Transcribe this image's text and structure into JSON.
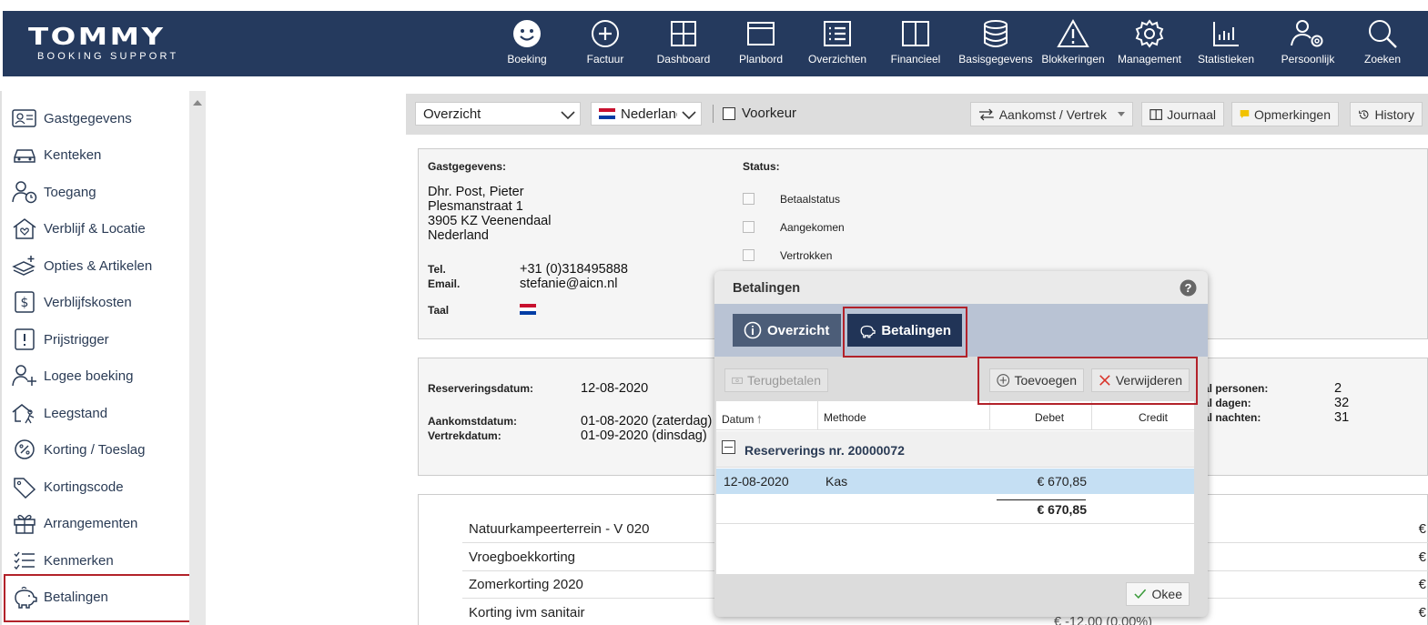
{
  "brand": {
    "name": "TOMMY",
    "tagline": "BOOKING SUPPORT"
  },
  "nav": [
    {
      "label": "Boeking",
      "icon": "smiley-icon"
    },
    {
      "label": "Factuur",
      "icon": "plus-circle-icon"
    },
    {
      "label": "Dashboard",
      "icon": "grid-icon"
    },
    {
      "label": "Planbord",
      "icon": "board-icon"
    },
    {
      "label": "Overzichten",
      "icon": "list-icon"
    },
    {
      "label": "Financieel",
      "icon": "book-icon"
    },
    {
      "label": "Basisgegevens",
      "icon": "database-icon"
    },
    {
      "label": "Blokkeringen",
      "icon": "warning-icon"
    },
    {
      "label": "Management",
      "icon": "gear-icon"
    },
    {
      "label": "Statistieken",
      "icon": "chart-icon"
    },
    {
      "label": "Persoonlijk",
      "icon": "user-gear-icon"
    },
    {
      "label": "Zoeken",
      "icon": "search-icon"
    }
  ],
  "sidebar": [
    {
      "label": "Gastgegevens",
      "icon": "id-card-icon"
    },
    {
      "label": "Kenteken",
      "icon": "car-icon"
    },
    {
      "label": "Toegang",
      "icon": "user-clock-icon"
    },
    {
      "label": "Verblijf & Locatie",
      "icon": "house-heart-icon"
    },
    {
      "label": "Opties & Artikelen",
      "icon": "layers-plus-icon"
    },
    {
      "label": "Verblijfskosten",
      "icon": "dollar-icon"
    },
    {
      "label": "Prijstrigger",
      "icon": "exclamation-icon"
    },
    {
      "label": "Logee boeking",
      "icon": "user-plus-icon"
    },
    {
      "label": "Leegstand",
      "icon": "house-walk-icon"
    },
    {
      "label": "Korting / Toeslag",
      "icon": "percent-icon"
    },
    {
      "label": "Kortingscode",
      "icon": "tag-icon"
    },
    {
      "label": "Arrangementen",
      "icon": "gift-icon"
    },
    {
      "label": "Kenmerken",
      "icon": "checklist-icon"
    },
    {
      "label": "Betalingen",
      "icon": "piggy-bank-icon"
    }
  ],
  "toolbar": {
    "view_select": "Overzicht",
    "language_select": "Nederlands",
    "preference_label": "Voorkeur",
    "arrival_btn": "Aankomst / Vertrek",
    "journal_btn": "Journaal",
    "remarks_btn": "Opmerkingen",
    "history_btn": "History"
  },
  "guest": {
    "heading": "Gastgegevens:",
    "name": "Dhr. Post, Pieter",
    "street": "Plesmanstraat 1",
    "city": "3905 KZ Veenendaal",
    "country": "Nederland",
    "tel_label": "Tel.",
    "tel": "+31 (0)318495888",
    "email_label": "Email.",
    "email": "stefanie@aicn.nl",
    "lang_label": "Taal"
  },
  "status": {
    "heading": "Status:",
    "items": [
      "Betaalstatus",
      "Aangekomen",
      "Vertrokken"
    ]
  },
  "reservation": {
    "date_label": "Reserveringsdatum:",
    "date": "12-08-2020",
    "arrival_label": "Aankomstdatum:",
    "arrival": "01-08-2020 (zaterdag)",
    "departure_label": "Vertrekdatum:",
    "departure": "01-09-2020 (dinsdag)",
    "persons_label": "al personen:",
    "persons": "2",
    "days_label": "al dagen:",
    "days": "32",
    "nights_label": "al nachten:",
    "nights": "31"
  },
  "lines": [
    {
      "label": "Natuurkampeerterrein - V 020",
      "trail": "€"
    },
    {
      "label": "Vroegboekkorting",
      "trail": "€"
    },
    {
      "label": "Zomerkorting 2020",
      "trail": "€"
    },
    {
      "label": "Korting ivm sanitair",
      "trail": "€"
    }
  ],
  "lines_partial": "€ -12,00 (0.00%)",
  "modal": {
    "title": "Betalingen",
    "tab_overview": "Overzicht",
    "tab_payments": "Betalingen",
    "refund_btn": "Terugbetalen",
    "add_btn": "Toevoegen",
    "delete_btn": "Verwijderen",
    "columns": {
      "date": "Datum",
      "method": "Methode",
      "debit": "Debet",
      "credit": "Credit"
    },
    "group": "Reserverings nr. 20000072",
    "row": {
      "date": "12-08-2020",
      "method": "Kas",
      "debit": "€ 670,85"
    },
    "total": "€ 670,85",
    "ok_btn": "Okee"
  },
  "colors": {
    "brand_navy": "#253a5e",
    "tab_active": "#213457",
    "highlight_red": "#b2222a",
    "row_selected": "#c5dff3"
  }
}
